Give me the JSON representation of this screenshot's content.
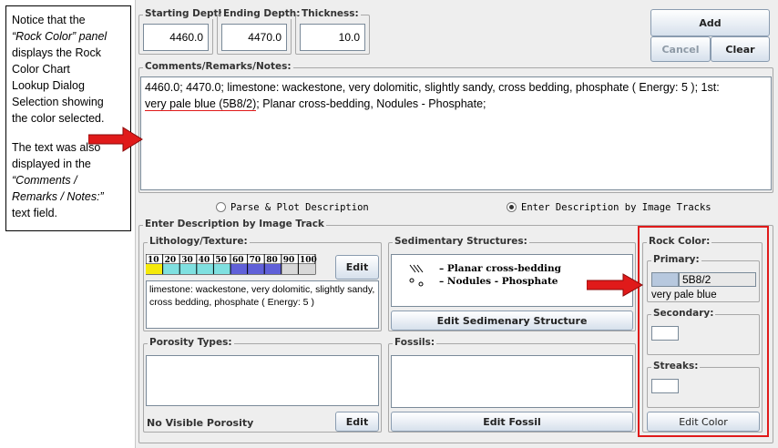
{
  "callout": {
    "line1": "Notice that the",
    "line2": "“Rock Color” panel",
    "line3": "displays the Rock",
    "line4": "Color Chart",
    "line5": "Lookup Dialog",
    "line6": "Selection showing",
    "line7": "the color selected.",
    "line8": "The  text was also",
    "line9": "displayed in the",
    "line10": "“Comments /",
    "line11": "Remarks / Notes:”",
    "line12": "text field."
  },
  "depth": {
    "starting_label": "Starting Depth:",
    "starting_value": "4460.0",
    "ending_label": "Ending Depth:",
    "ending_value": "4470.0",
    "thickness_label": "Thickness:",
    "thickness_value": "10.0"
  },
  "actions": {
    "add": "Add",
    "cancel": "Cancel",
    "clear": "Clear"
  },
  "comments": {
    "label": "Comments/Remarks/Notes:",
    "line1": "4460.0; 4470.0; limestone:  wackestone, very dolomitic, slightly sandy, cross bedding, phosphate ( Energy: 5 ); 1st:",
    "line2a": "very pale blue (5B8/2)",
    "line2b": "; Planar cross-bedding, Nodules - Phosphate;"
  },
  "mode": {
    "parse_label": "Parse & Plot Description",
    "image_label": "Enter Description by Image Tracks",
    "selected": "image"
  },
  "image_track": {
    "label": "Enter Description by Image Track",
    "lithology": {
      "label": "Lithology/Texture:",
      "scale": [
        "10",
        "20",
        "30",
        "40",
        "50",
        "60",
        "70",
        "80",
        "90",
        "100"
      ],
      "edit": "Edit",
      "description": "limestone:  wackestone, very dolomitic, slightly sandy, cross bedding, phosphate ( Energy: 5 )"
    },
    "sedimentary": {
      "label": "Sedimentary Structures:",
      "items": [
        "– Planar cross-bedding",
        "– Nodules - Phosphate"
      ],
      "edit": "Edit Sedimenary Structure"
    },
    "porosity": {
      "label": "Porosity Types:",
      "value": "No Visible Porosity",
      "edit": "Edit"
    },
    "fossils": {
      "label": "Fossils:",
      "edit": "Edit Fossil"
    },
    "rock_color": {
      "label": "Rock Color:",
      "primary_label": "Primary:",
      "primary_code": "5B8/2",
      "primary_name": "very pale blue",
      "primary_swatch": "#b7c8de",
      "secondary_label": "Secondary:",
      "streaks_label": "Streaks:",
      "edit": "Edit Color"
    }
  },
  "colors": {
    "highlight": "#e01a1a"
  }
}
